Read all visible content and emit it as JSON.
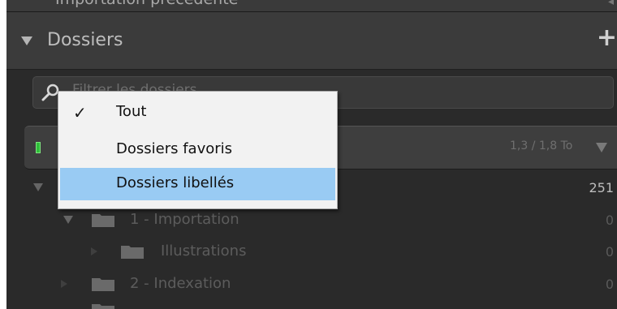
{
  "previous_panel": {
    "title": "Importation précédente"
  },
  "folders_panel": {
    "title": "Dossiers",
    "add_label": "+",
    "filter_placeholder": "Filtrer les dossiers",
    "volume": {
      "size": "1,3 / 1,8 To",
      "status_color": "#2fbf3a"
    },
    "root": {
      "count": "251"
    },
    "tree": [
      {
        "label": "1 - Importation",
        "count": "0"
      },
      {
        "label": "Illustrations",
        "count": "0"
      },
      {
        "label": "2 - Indexation",
        "count": "0"
      }
    ]
  },
  "filter_menu": {
    "items": [
      {
        "label": "Tout",
        "checked": true,
        "selected": false
      },
      {
        "label": "Dossiers favoris",
        "checked": false,
        "selected": false
      },
      {
        "label": "Dossiers libellés",
        "checked": false,
        "selected": true
      }
    ],
    "check_glyph": "✓",
    "highlight_color": "#99cbf3"
  }
}
